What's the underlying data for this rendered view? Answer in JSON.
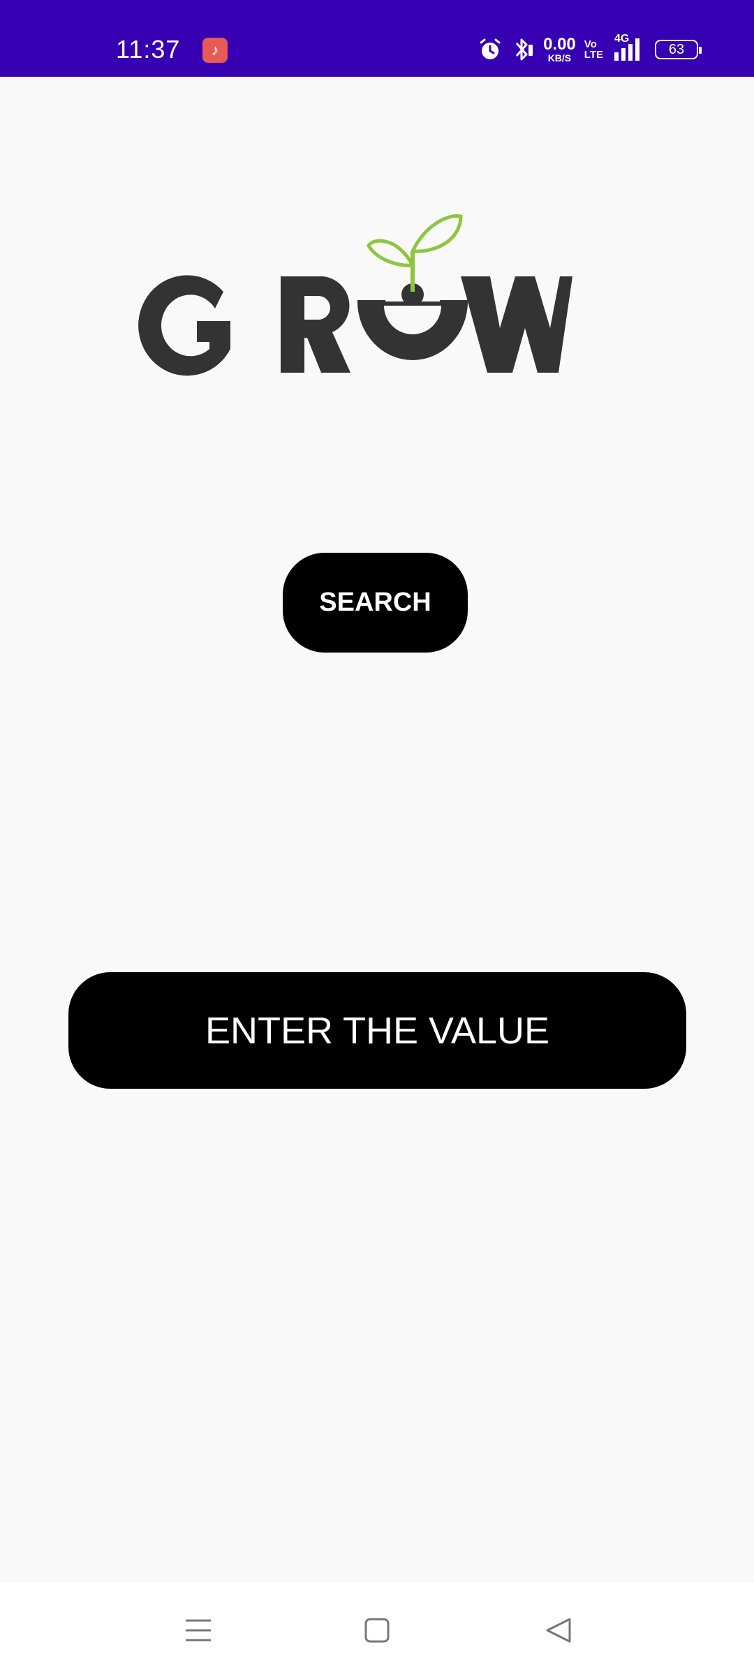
{
  "status_bar": {
    "time": "11:37",
    "data_speed_value": "0.00",
    "data_speed_unit": "KB/S",
    "volte_top": "Vo",
    "volte_bottom": "LTE",
    "network": "4G",
    "battery": "63",
    "icons": [
      "music-icon",
      "alarm-icon",
      "bluetooth-icon",
      "signal-icon",
      "battery-icon"
    ]
  },
  "logo": {
    "text": "GROW",
    "colors": {
      "letters": "#333333",
      "leaf": "#8dc63f"
    }
  },
  "main": {
    "search_label": "SEARCH",
    "enter_label": "ENTER THE VALUE"
  },
  "nav_bar": {
    "icons": [
      "menu-icon",
      "home-icon",
      "back-icon"
    ]
  },
  "colors": {
    "status_bar": "#3700b3",
    "background": "#f9f9f9",
    "button": "#000000",
    "button_text": "#ffffff"
  }
}
